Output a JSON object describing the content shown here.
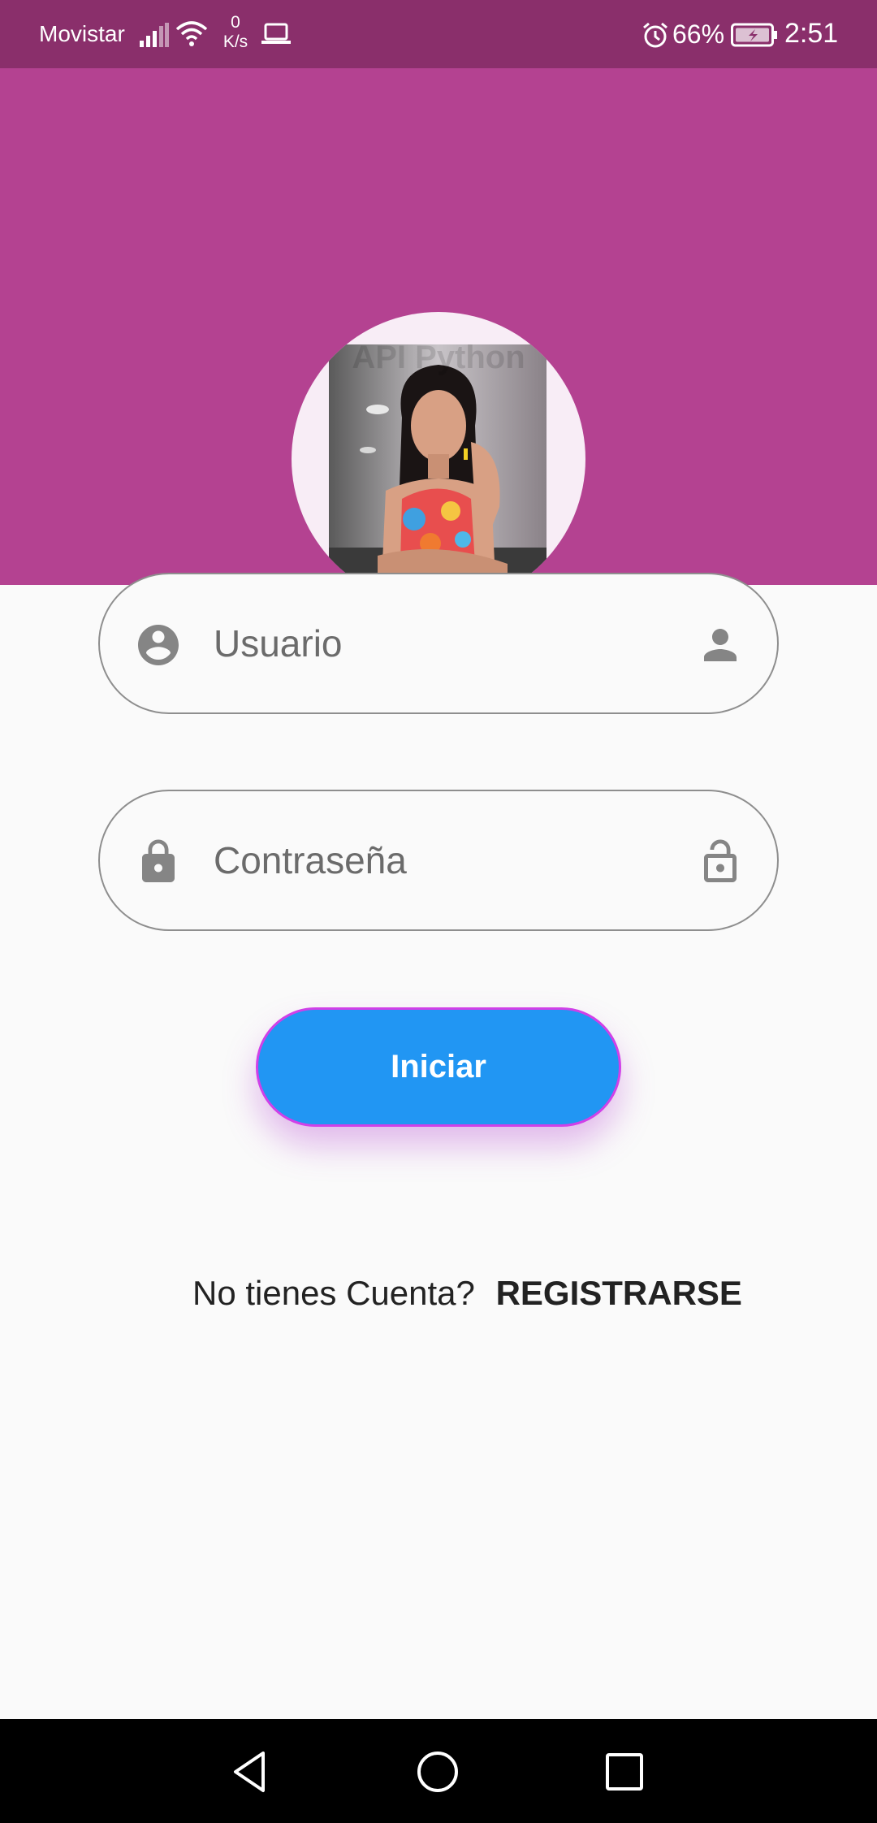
{
  "status_bar": {
    "carrier": "Movistar",
    "net_speed_value": "0",
    "net_speed_unit": "K/s",
    "battery_percent": "66%",
    "time": "2:51",
    "icons": [
      "signal-icon",
      "wifi-icon",
      "laptop-icon",
      "alarm-icon",
      "battery-charging-icon"
    ]
  },
  "header": {
    "background_color": "#b44291",
    "avatar_watermark": "API Python"
  },
  "form": {
    "username": {
      "placeholder": "Usuario",
      "value": "",
      "prefix_icon": "account-circle-icon",
      "suffix_icon": "person-icon"
    },
    "password": {
      "placeholder": "Contraseña",
      "value": "",
      "prefix_icon": "lock-icon",
      "suffix_icon": "lock-open-icon"
    }
  },
  "login_button": {
    "label": "Iniciar",
    "color": "#2196f3"
  },
  "register": {
    "prompt": "No tienes Cuenta?",
    "link_label": "REGISTRARSE"
  },
  "nav_bar": {
    "icons": [
      "back-icon",
      "home-icon",
      "recent-apps-icon"
    ]
  }
}
